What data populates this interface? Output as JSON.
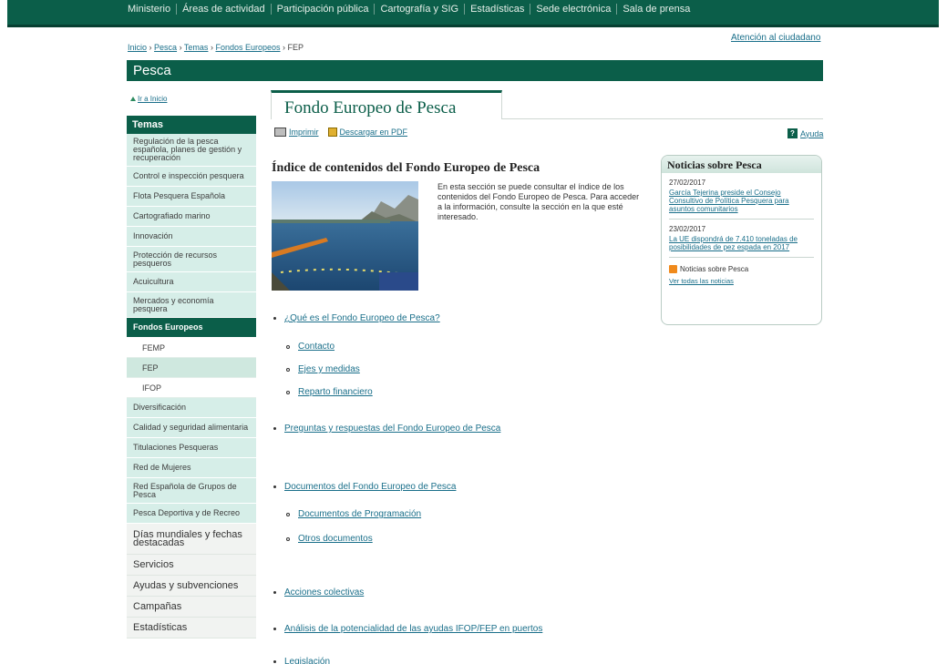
{
  "topnav": [
    "Ministerio",
    "Áreas de actividad",
    "Participación pública",
    "Cartografía y SIG",
    "Estadísticas",
    "Sede electrónica",
    "Sala de prensa"
  ],
  "atencion": "Atención al ciudadano",
  "breadcrumb": {
    "inicio": "Inicio",
    "pesca": "Pesca",
    "temas": "Temas",
    "fondos": "Fondos Europeos",
    "current": "FEP",
    "sep": "›"
  },
  "section_title": "Pesca",
  "ir_inicio": "Ir a Inicio",
  "sidebar": {
    "head": "Temas",
    "items": [
      "Regulación de la pesca española, planes de gestión y recuperación",
      "Control e inspección pesquera",
      "Flota Pesquera Española",
      "Cartografiado marino",
      "Innovación",
      "Protección de recursos pesqueros",
      "Acuicultura",
      "Mercados y economía pesquera",
      "Fondos Europeos"
    ],
    "subitems": [
      "FEMP",
      "FEP",
      "IFOP"
    ],
    "items2": [
      "Diversificación",
      "Calidad y seguridad alimentaria",
      "Titulaciones Pesqueras",
      "Red de Mujeres",
      "Red Española de Grupos de Pesca",
      "Pesca Deportiva y de Recreo"
    ],
    "plain": [
      "Días mundiales y fechas destacadas",
      "Servicios",
      "Ayudas y subvenciones",
      "Campañas",
      "Estadísticas"
    ]
  },
  "page_title": "Fondo Europeo de Pesca",
  "toolbar": {
    "print": "Imprimir",
    "pdf": "Descargar en PDF",
    "help": "Ayuda"
  },
  "heading": "Índice de contenidos del Fondo Europeo de Pesca",
  "intro": "En esta sección se puede consultar el índice de los contenidos del Fondo Europeo de Pesca. Para acceder a la información, consulte la sección en la que esté interesado.",
  "noticias": {
    "title": "Noticias sobre Pesca",
    "items": [
      {
        "date": "27/02/2017",
        "text": "García Tejerina preside el Consejo Consultivo de Política Pesquera para asuntos comunitarios"
      },
      {
        "date": "23/02/2017",
        "text": "La UE dispondrá de 7.410 toneladas de posibilidades de pez espada en 2017"
      }
    ],
    "rss": "Noticias sobre Pesca",
    "ver_todas": "Ver todas las noticias"
  },
  "contents": {
    "l1": "¿Qué es el Fondo Europeo de Pesca?",
    "l1_sub": [
      "Contacto",
      "Ejes y medidas",
      "Reparto financiero"
    ],
    "l2": "Preguntas y respuestas del Fondo Europeo de Pesca",
    "l3": "Documentos del Fondo Europeo de Pesca",
    "l3_sub": [
      "Documentos de Programación",
      "Otros documentos"
    ],
    "l4": "Acciones colectivas",
    "l5": "Análisis de la potencialidad de las ayudas IFOP/FEP en puertos",
    "l6": "Legislación"
  },
  "colors": {
    "brand_green": "#0b5e49",
    "sidebar_bg": "#d6eee8",
    "link": "#1a6f8a"
  }
}
